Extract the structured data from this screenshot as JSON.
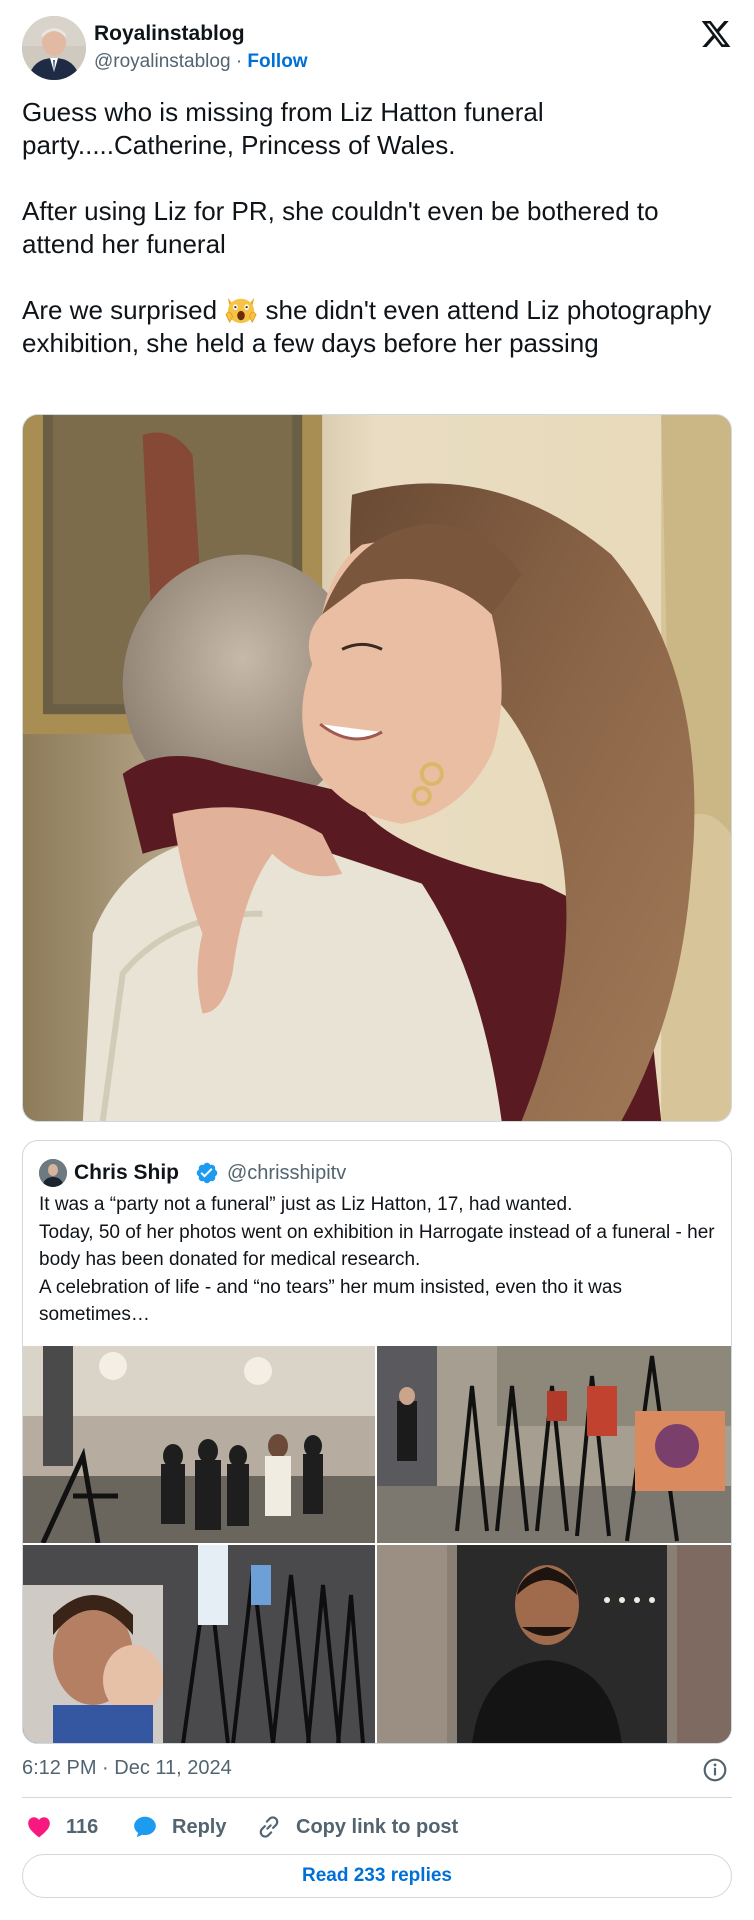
{
  "author": {
    "display_name": "Royalinstablog",
    "handle": "@royalinstablog",
    "separator": "·",
    "follow_label": "Follow"
  },
  "tweet": {
    "paragraphs": [
      "Guess who is missing from Liz Hatton funeral party.....Catherine, Princess of Wales.",
      "After using Liz for PR, she couldn't even be bothered to attend her funeral",
      "she didn't even attend Liz photography exhibition, she held a few days before her passing"
    ],
    "surprised_prefix": "Are we surprised",
    "emoji_name": "face-screaming-in-fear-cat-emoji"
  },
  "quote": {
    "display_name": "Chris Ship",
    "handle": "@chrisshipitv",
    "verified_color": "#1d9bf0",
    "text": "It was a “party not a funeral” just as Liz Hatton, 17, had wanted.\nToday, 50 of her photos went on exhibition in Harrogate instead of a funeral - her body has been donated for medical research.\nA celebration of life - and “no tears” her mum insisted, even tho it was sometimes…"
  },
  "meta": {
    "timestamp": "6:12 PM · Dec 11, 2024"
  },
  "actions": {
    "like_count": "116",
    "reply_label": "Reply",
    "copy_label": "Copy link to post",
    "read_replies_label": "Read 233 replies"
  },
  "colors": {
    "accent": "#006fd6",
    "like": "#f91880",
    "reply": "#1d9bf0",
    "secondary_text": "#536471",
    "border": "#cfd9de"
  }
}
